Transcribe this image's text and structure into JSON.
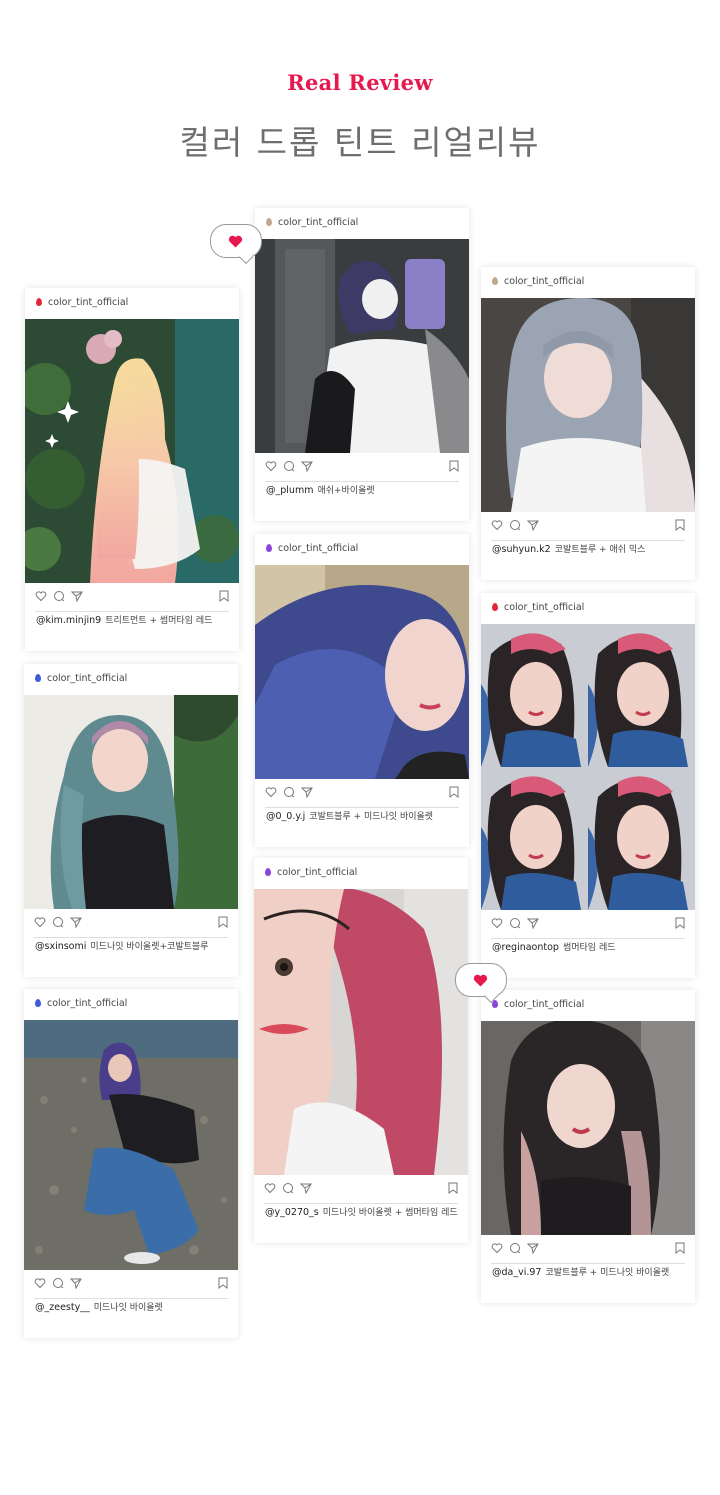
{
  "header": {
    "en": "Real Review",
    "ko": "컬러 드롭 틴트 리얼리뷰"
  },
  "colors": {
    "accent": "#e6194f",
    "drop_red": "#e0283c",
    "drop_blue": "#3d5bd9",
    "drop_purple": "#8b45d8",
    "drop_beige": "#c0a98e"
  },
  "posts": [
    {
      "account": "color_tint_official",
      "user": "@kim.minjin9",
      "caption": "트리트먼트 + 썸머타임 레드"
    },
    {
      "account": "color_tint_official",
      "user": "@sxinsomi",
      "caption": "미드나잇 바이올렛+코발트블루"
    },
    {
      "account": "color_tint_official",
      "user": "@_zeesty__",
      "caption": "미드나잇 바이올렛"
    },
    {
      "account": "color_tint_official",
      "user": "@_plumm",
      "caption": "애쉬+바이올렛"
    },
    {
      "account": "color_tint_official",
      "user": "@0_0.y.j",
      "caption": "코발트블루 + 미드나잇 바이올렛"
    },
    {
      "account": "color_tint_official",
      "user": "@y_0270_s",
      "caption": "미드나잇 바이올렛 + 썸머타임 레드"
    },
    {
      "account": "color_tint_official",
      "user": "@suhyun.k2",
      "caption": "코발트블루 + 애쉬 믹스"
    },
    {
      "account": "color_tint_official",
      "user": "@reginaontop",
      "caption": "썸머타임 레드"
    },
    {
      "account": "color_tint_official",
      "user": "@da_vi.97",
      "caption": "코발트블루 + 미드나잇 바이올렛"
    }
  ],
  "icons": [
    "heart-icon",
    "comment-icon",
    "share-icon",
    "bookmark-icon",
    "drop-icon",
    "heart-bubble-icon"
  ]
}
